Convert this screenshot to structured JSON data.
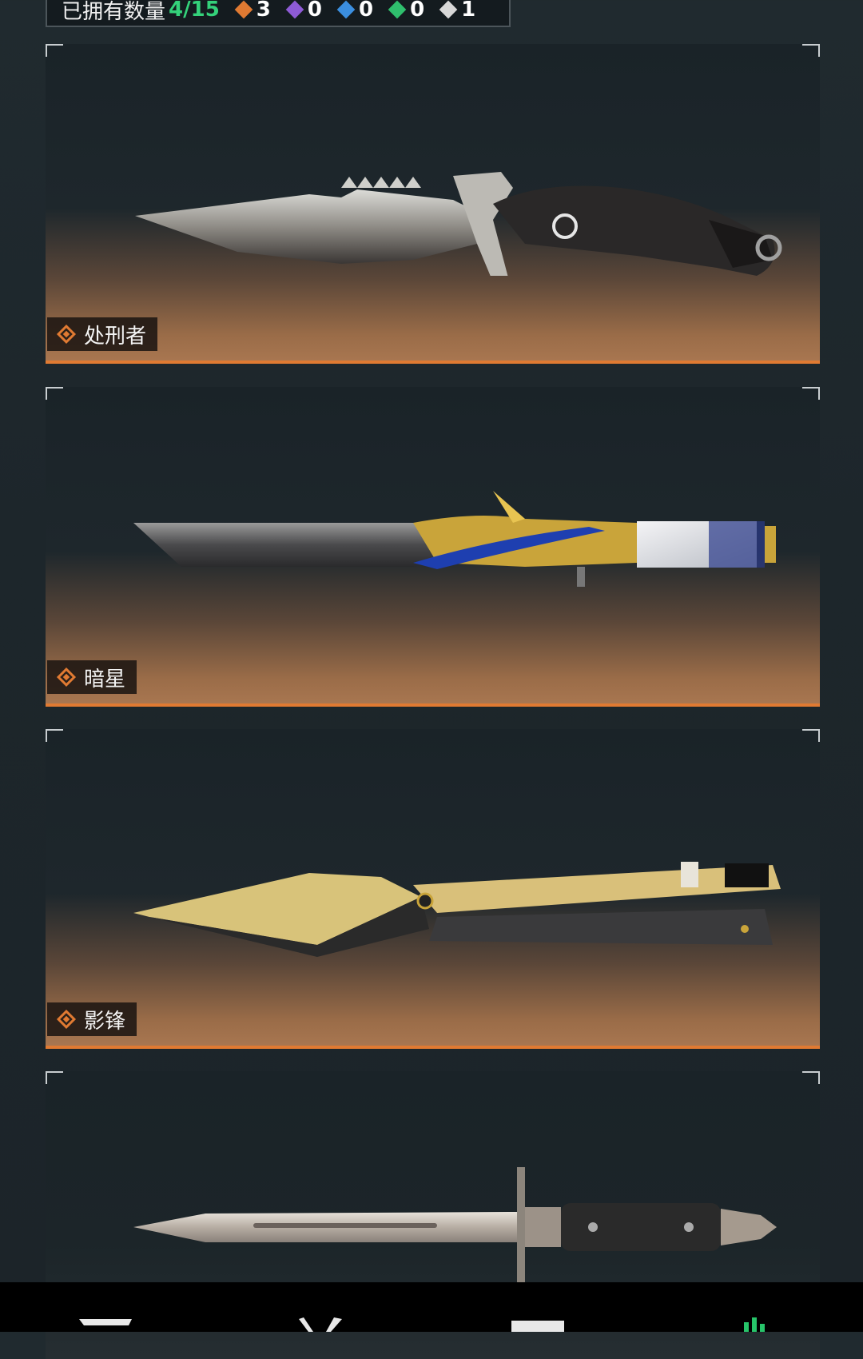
{
  "header": {
    "owned_label": "已拥有数量",
    "owned_count": "4/15",
    "rarities": [
      {
        "name": "orange",
        "color": "#e07a32",
        "count": "3"
      },
      {
        "name": "purple",
        "color": "#8e5bd6",
        "count": "0"
      },
      {
        "name": "blue",
        "color": "#3b8fe0",
        "count": "0"
      },
      {
        "name": "green",
        "color": "#2fbf6d",
        "count": "0"
      },
      {
        "name": "white",
        "color": "#d8d8d8",
        "count": "1"
      }
    ]
  },
  "cards": [
    {
      "name": "处刑者",
      "rarity": "orange"
    },
    {
      "name": "暗星",
      "rarity": "orange"
    },
    {
      "name": "影锋",
      "rarity": "orange"
    },
    {
      "name": "",
      "rarity": "white"
    }
  ],
  "bottom_nav": {
    "icons": [
      "filter-icon",
      "tools-icon",
      "upload-icon",
      "stats-icon"
    ]
  }
}
